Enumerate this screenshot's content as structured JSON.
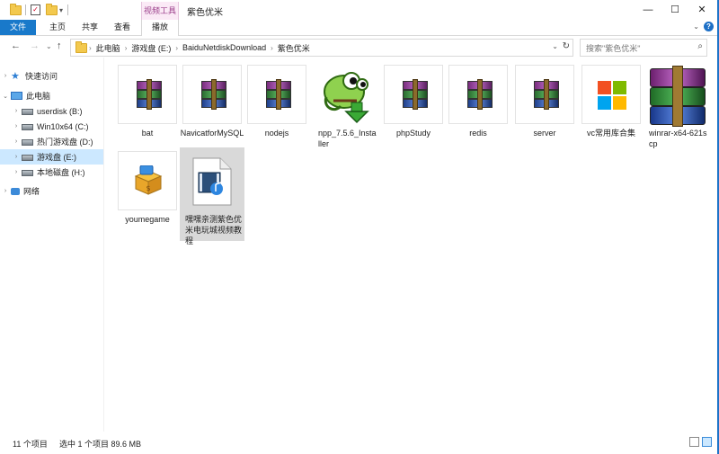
{
  "window": {
    "title": "紫色优米",
    "context_tab_group": "视频工具",
    "controls": {
      "minimize": "—",
      "maximize": "☐",
      "close": "✕"
    }
  },
  "ribbon": {
    "tabs": [
      "文件",
      "主页",
      "共享",
      "查看",
      "播放"
    ]
  },
  "address": {
    "back": "←",
    "forward": "→",
    "up": "↑",
    "crumbs": [
      "此电脑",
      "游戏盘 (E:)",
      "BaiduNetdiskDownload",
      "紫色优米"
    ],
    "search_placeholder": "搜索\"紫色优米\""
  },
  "navpane": {
    "items": [
      {
        "label": "快速访问",
        "icon": "star-icon"
      },
      {
        "label": "此电脑",
        "icon": "computer-icon"
      },
      {
        "label": "userdisk (B:)",
        "icon": "drive-icon"
      },
      {
        "label": "Win10x64 (C:)",
        "icon": "drive-icon"
      },
      {
        "label": "热门游戏盘 (D:)",
        "icon": "drive-icon"
      },
      {
        "label": "游戏盘 (E:)",
        "icon": "drive-icon",
        "selected": true
      },
      {
        "label": "本地磁盘 (H:)",
        "icon": "drive-icon"
      },
      {
        "label": "网络",
        "icon": "network-icon"
      }
    ]
  },
  "files": [
    {
      "name": "bat",
      "icon": "winrar-archive-icon"
    },
    {
      "name": "NavicatforMySQL",
      "icon": "winrar-archive-icon"
    },
    {
      "name": "nodejs",
      "icon": "winrar-archive-icon"
    },
    {
      "name": "npp_7.5.6_Installer",
      "icon": "notepadpp-installer-icon"
    },
    {
      "name": "phpStudy",
      "icon": "winrar-archive-icon"
    },
    {
      "name": "redis",
      "icon": "winrar-archive-icon"
    },
    {
      "name": "server",
      "icon": "winrar-archive-icon"
    },
    {
      "name": "vc常用库合集",
      "icon": "windows-logo-icon"
    },
    {
      "name": "winrar-x64-621scp",
      "icon": "winrar-installer-icon"
    },
    {
      "name": "youmegame",
      "icon": "package-box-icon"
    },
    {
      "name": "嘿嘿亲测紫色优米电玩城视频教程",
      "icon": "video-file-icon",
      "selected": true
    }
  ],
  "status": {
    "count": "11 个项目",
    "selection": "选中 1 个项目  89.6 MB"
  },
  "colors": {
    "file_tab": "#1979ca",
    "context_tab": "#9b3f8a",
    "selection": "#cce8ff"
  }
}
